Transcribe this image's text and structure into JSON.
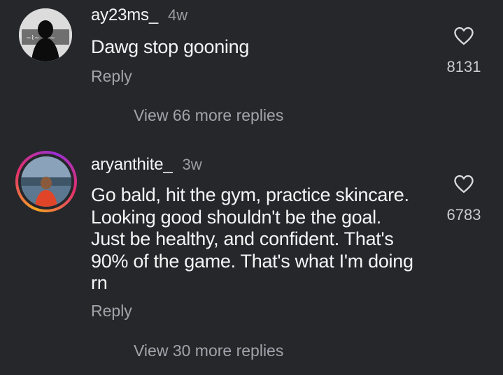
{
  "comments": [
    {
      "username": "ay23ms_",
      "time": "4w",
      "text": "Dawg stop gooning",
      "reply_label": "Reply",
      "like_count": "8131",
      "view_more_label": "View 66 more replies"
    },
    {
      "username": "aryanthite_",
      "time": "3w",
      "text": "Go bald, hit the gym, practice skincare. Looking good shouldn't be the goal. Just be healthy, and confident. That's 90% of the game. That's what I'm doing rn",
      "reply_label": "Reply",
      "like_count": "6783",
      "view_more_label": "View 30 more replies"
    }
  ],
  "colors": {
    "background": "#25272b",
    "primary_text": "#f5f5f5",
    "secondary_text": "#a1a4aa",
    "story_ring_start": "#f5a623",
    "story_ring_mid": "#e1306c",
    "story_ring_end": "#9b2fd6"
  },
  "icons": {
    "like": "heart-outline-icon"
  }
}
